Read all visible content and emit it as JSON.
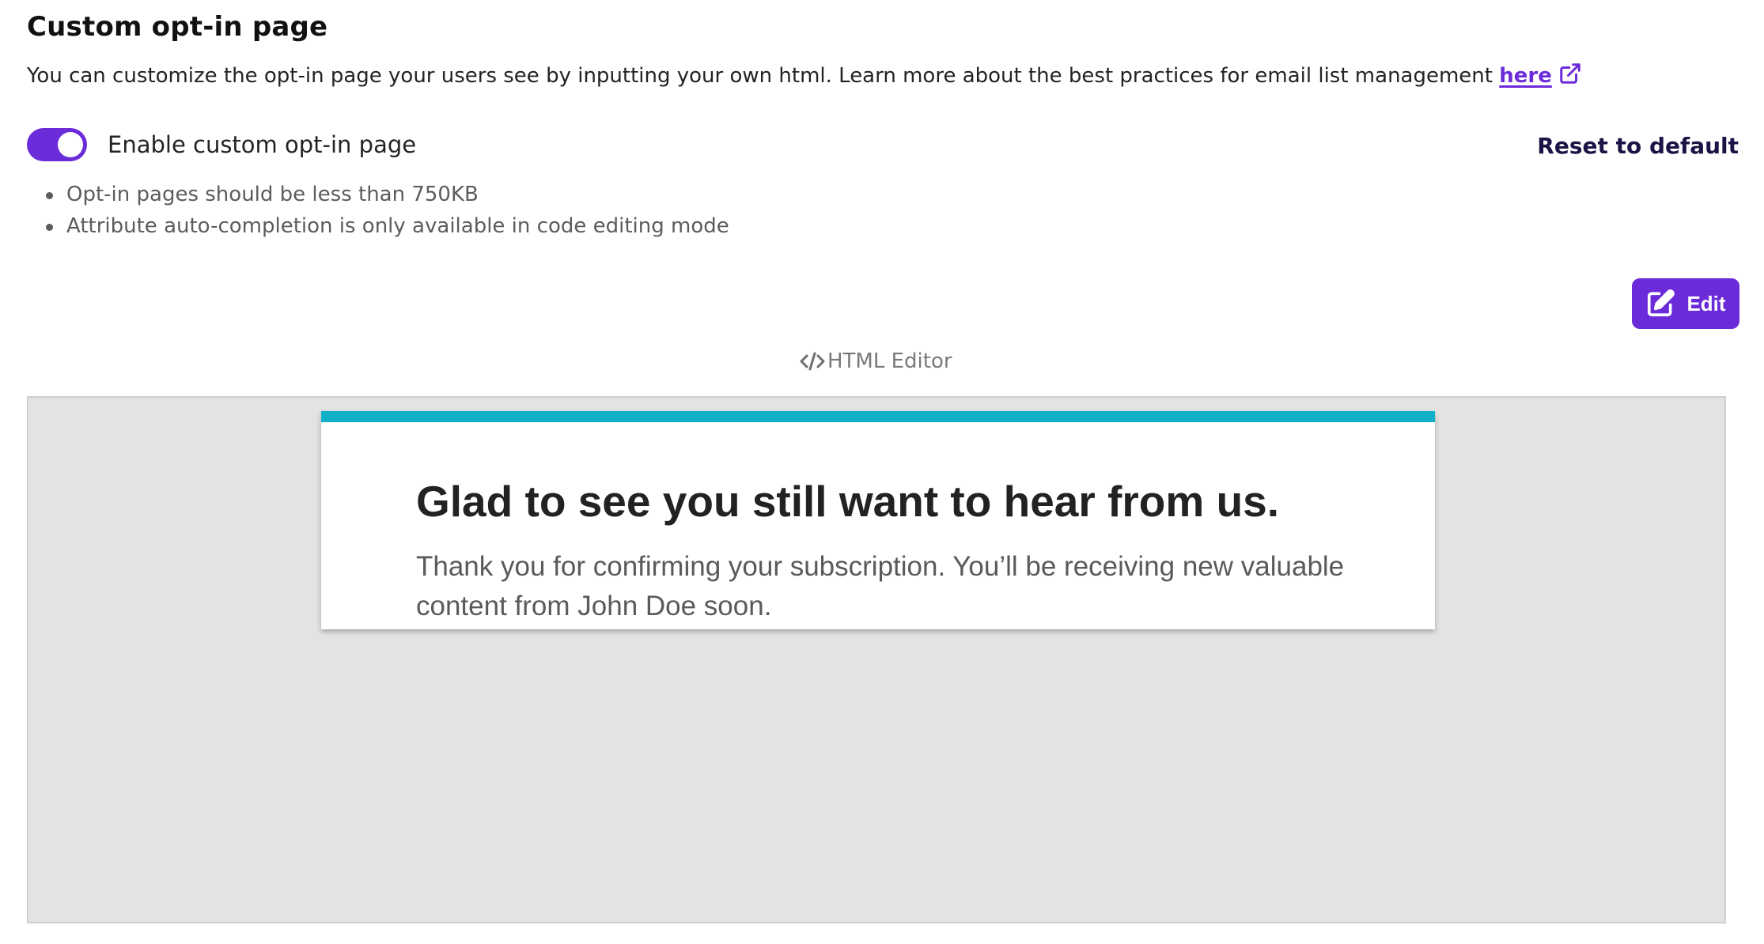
{
  "section": {
    "title": "Custom opt-in page",
    "description_text": "You can customize the opt-in page your users see by inputting your own html. Learn more about the best practices for email list management ",
    "learn_more_link": "here",
    "link_icon": "external-link-icon"
  },
  "toggle": {
    "label": "Enable custom opt-in page",
    "state": "on"
  },
  "reset_label": "Reset to default",
  "notes": [
    "Opt-in pages should be less than 750KB",
    "Attribute auto-completion is only available in code editing mode"
  ],
  "edit_button": {
    "label": "Edit",
    "icon": "edit-icon"
  },
  "editor": {
    "label": "HTML Editor",
    "icon": "code-icon"
  },
  "preview": {
    "heading": "Glad to see you still want to hear from us.",
    "body": "Thank you for confirming your subscription. You’ll be receiving new valuable content from John Doe soon."
  },
  "colors": {
    "brand_purple": "#6c2bd9",
    "preview_accent": "#0fb0c8",
    "preview_background": "#e3e3e3",
    "reset_text": "#1b1446"
  }
}
